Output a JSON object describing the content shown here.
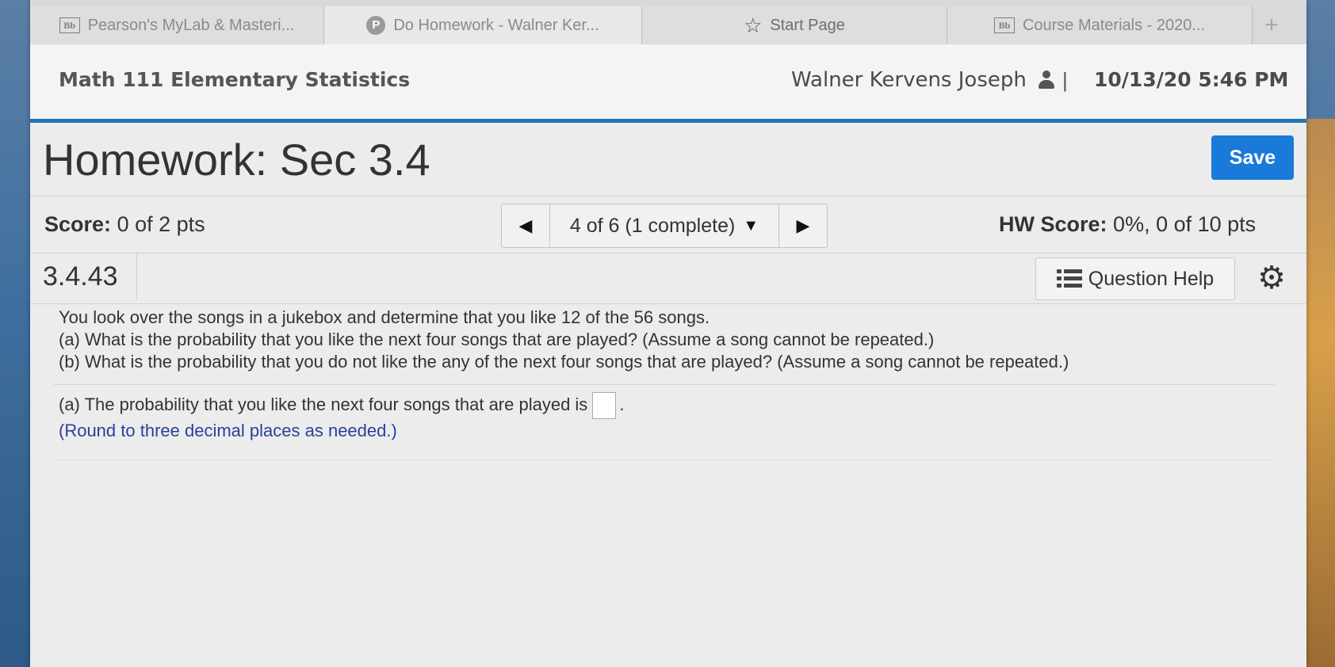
{
  "tabs": [
    {
      "label": "Pearson's MyLab & Masteri...",
      "icon": "bb-icon",
      "icon_text": "Bb"
    },
    {
      "label": "Do Homework - Walner Ker...",
      "icon": "pearson-icon",
      "icon_text": "P"
    },
    {
      "label": "Start Page",
      "icon": "star-icon",
      "icon_text": "☆"
    },
    {
      "label": "Course Materials - 2020...",
      "icon": "bb-icon",
      "icon_text": "Bb"
    }
  ],
  "new_tab_label": "+",
  "header": {
    "course": "Math 111 Elementary Statistics",
    "user": "Walner Kervens Joseph",
    "separator": "|",
    "datetime": "10/13/20 5:46 PM"
  },
  "homework": {
    "title": "Homework: Sec 3.4",
    "save_label": "Save",
    "score_label": "Score:",
    "score_value": "0 of 2 pts",
    "nav_position": "4 of 6 (1 complete)",
    "nav_caret": "▼",
    "prev_arrow": "◀",
    "next_arrow": "▶",
    "hw_score_label": "HW Score:",
    "hw_score_value": "0%, 0 of 10 pts",
    "question_number": "3.4.43",
    "question_help_label": "Question Help",
    "gear_glyph": "⚙"
  },
  "problem": {
    "intro": "You look over the songs in a jukebox and determine that you like 12 of the 56 songs.",
    "part_a": "(a) What is the probability that you like the next four songs that are played? (Assume a song cannot be repeated.)",
    "part_b": "(b) What is the probability that you do not like the any of the next four songs that are played? (Assume a song cannot be repeated.)"
  },
  "answer": {
    "prompt": "(a) The probability that you like the next four songs that are played is",
    "suffix": ".",
    "hint": "(Round to three decimal places as needed.)"
  },
  "colors": {
    "accent": "#1f78b4",
    "save_button": "#1a7ad9",
    "hint_text": "#2a3f9c"
  }
}
